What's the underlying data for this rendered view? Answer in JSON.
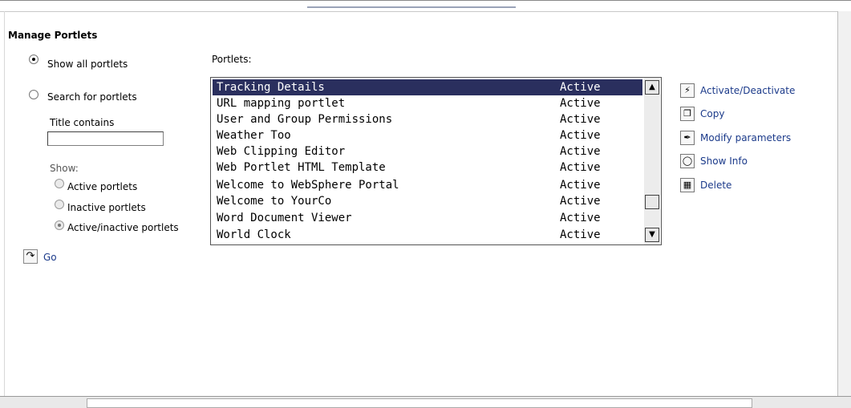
{
  "page": {
    "title": "Manage Portlets"
  },
  "filter": {
    "show_all_label": "Show all portlets",
    "search_label": "Search for portlets",
    "title_contains_label": "Title contains",
    "title_contains_value": "",
    "show_label": "Show:",
    "active_label": "Active portlets",
    "inactive_label": "Inactive portlets",
    "both_label": "Active/inactive portlets",
    "go_label": "Go",
    "selected_mode": "show_all"
  },
  "list": {
    "header": "Portlets:",
    "rows": [
      {
        "name": "Tracking Details",
        "status": "Active",
        "selected": true
      },
      {
        "name": "URL mapping portlet",
        "status": "Active"
      },
      {
        "name": "User and Group Permissions",
        "status": "Active"
      },
      {
        "name": "Weather Too",
        "status": "Active"
      },
      {
        "name": "Web Clipping Editor",
        "status": "Active"
      },
      {
        "name": "Web Portlet HTML Template",
        "status": "Active"
      },
      {
        "name": "Welcome to WebSphere Portal",
        "status": "Active"
      },
      {
        "name": "Welcome to YourCo",
        "status": "Active"
      },
      {
        "name": "Word Document Viewer",
        "status": "Active"
      },
      {
        "name": "World Clock",
        "status": "Active"
      }
    ]
  },
  "actions": [
    {
      "label": "Activate/Deactivate",
      "icon": "lightning-icon"
    },
    {
      "label": "Copy",
      "icon": "copy-icon"
    },
    {
      "label": "Modify parameters",
      "icon": "wrench-icon"
    },
    {
      "label": "Show Info",
      "icon": "glasses-icon"
    },
    {
      "label": "Delete",
      "icon": "trash-icon"
    }
  ]
}
